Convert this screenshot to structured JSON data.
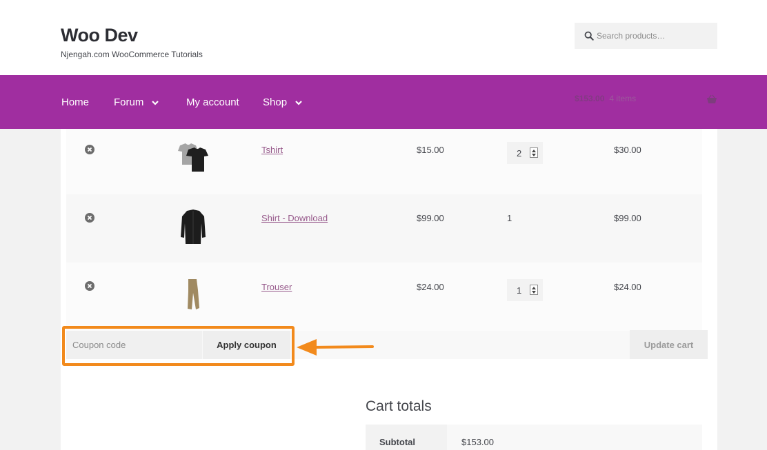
{
  "site": {
    "title": "Woo Dev",
    "description": "Njengah.com WooCommerce Tutorials"
  },
  "search": {
    "placeholder": "Search products…",
    "icon": "search-icon"
  },
  "nav": {
    "items": [
      {
        "label": "Home",
        "has_dropdown": false
      },
      {
        "label": "Forum",
        "has_dropdown": true
      },
      {
        "label": "My account",
        "has_dropdown": false
      },
      {
        "label": "Shop",
        "has_dropdown": true
      }
    ],
    "mini_cart": {
      "amount": "$153.00",
      "count": "4 items",
      "icon": "basket-icon"
    }
  },
  "cart": {
    "items": [
      {
        "name": "Tshirt",
        "price": "$15.00",
        "quantity": "2",
        "quantity_editable": true,
        "subtotal": "$30.00",
        "thumb_icon": "tshirt-thumbnail"
      },
      {
        "name": "Shirt - Download",
        "price": "$99.00",
        "quantity": "1",
        "quantity_editable": false,
        "subtotal": "$99.00",
        "thumb_icon": "shirt-thumbnail"
      },
      {
        "name": "Trouser",
        "price": "$24.00",
        "quantity": "1",
        "quantity_editable": true,
        "subtotal": "$24.00",
        "thumb_icon": "trouser-thumbnail"
      }
    ],
    "coupon": {
      "placeholder": "Coupon code",
      "apply_label": "Apply coupon"
    },
    "update_label": "Update cart"
  },
  "totals": {
    "title": "Cart totals",
    "rows": [
      {
        "label": "Subtotal",
        "value": "$153.00"
      }
    ]
  },
  "colors": {
    "brand_purple": "#a02ea0",
    "link": "#96588a",
    "annotation_orange": "#f28a1c"
  }
}
